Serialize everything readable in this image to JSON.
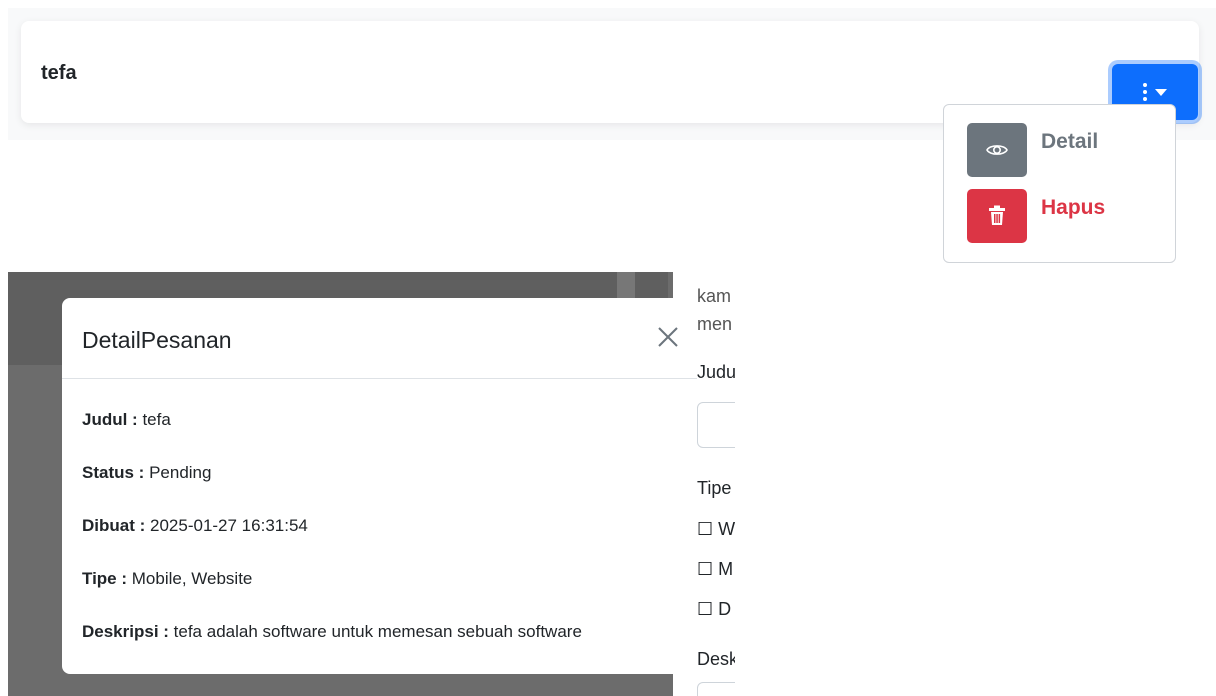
{
  "card": {
    "title": "tefa"
  },
  "dropdown": {
    "detail_label": "Detail",
    "delete_label": "Hapus",
    "detail_icon": "eye-icon",
    "delete_icon": "trash-icon"
  },
  "background_form": {
    "text_lines": [
      "kam",
      "men"
    ],
    "judul_label": "Judu",
    "tipe_label": "Tipe",
    "checkbox_options": [
      "☐ W",
      "☐ M",
      "☐ D"
    ],
    "deskripsi_label": "Desk"
  },
  "modal": {
    "title": "DetailPesanan",
    "close_icon": "close-icon",
    "fields": [
      {
        "label": "Judul :",
        "value": " tefa"
      },
      {
        "label": "Status :",
        "value": " Pending"
      },
      {
        "label": "Dibuat :",
        "value": " 2025-01-27 16:31:54"
      },
      {
        "label": "Tipe :",
        "value": " Mobile, Website"
      },
      {
        "label": "Deskripsi :",
        "value": " tefa adalah software untuk memesan sebuah software"
      }
    ]
  },
  "colors": {
    "primary": "#0d6efd",
    "secondary": "#6c757d",
    "danger": "#dc3545"
  }
}
